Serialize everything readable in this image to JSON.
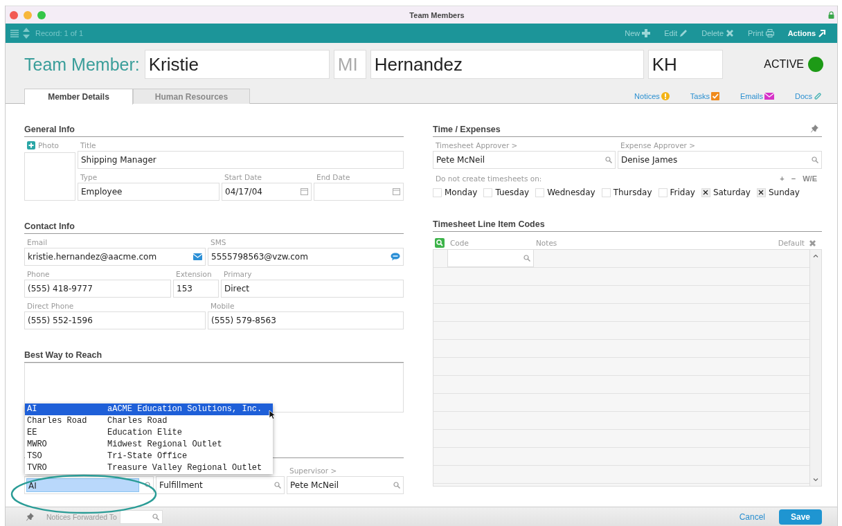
{
  "window": {
    "title": "Team Members",
    "locked": true
  },
  "toolbar": {
    "record": "Record: 1 of 1",
    "actions": [
      {
        "label": "New",
        "kind": "new",
        "disabled": true
      },
      {
        "label": "Edit",
        "kind": "edit",
        "disabled": true
      },
      {
        "label": "Delete",
        "kind": "delete",
        "disabled": true
      },
      {
        "label": "Print",
        "kind": "print",
        "disabled": true
      },
      {
        "label": "Actions",
        "kind": "actions",
        "disabled": false
      }
    ]
  },
  "header": {
    "label": "Team Member:",
    "first_name": "Kristie",
    "middle_initial": {
      "placeholder": "MI"
    },
    "last_name": "Hernandez",
    "initials": "KH",
    "status": "ACTIVE",
    "active": true
  },
  "tabs": [
    {
      "label": "Member Details",
      "selected": true
    },
    {
      "label": "Human Resources",
      "selected": false
    }
  ],
  "links": [
    {
      "label": "Notices",
      "kind": "notices"
    },
    {
      "label": "Tasks",
      "kind": "tasks"
    },
    {
      "label": "Emails",
      "kind": "emails"
    },
    {
      "label": "Docs",
      "kind": "docs"
    }
  ],
  "general_info": {
    "title": "General Info",
    "photo": "Photo",
    "title_field": {
      "label": "Title",
      "value": "Shipping Manager"
    },
    "type": {
      "label": "Type",
      "value": "Employee"
    },
    "start_date": {
      "label": "Start Date",
      "value": "04/17/04"
    },
    "end_date": {
      "label": "End Date"
    }
  },
  "contact_info": {
    "title": "Contact Info",
    "email": {
      "label": "Email",
      "value": "kristie.hernandez@aacme.com"
    },
    "sms": {
      "label": "SMS",
      "value": "5555798563@vzw.com"
    },
    "phone": {
      "label": "Phone",
      "value": "(555) 418-9777"
    },
    "extension": {
      "label": "Extension",
      "value": "153"
    },
    "primary": {
      "label": "Primary",
      "value": "Direct"
    },
    "direct_phone": {
      "label": "Direct Phone",
      "value": "(555) 552-1596"
    },
    "mobile": {
      "label": "Mobile",
      "value": "(555) 579-8563"
    }
  },
  "best_way": {
    "title": "Best Way to Reach"
  },
  "lower_fields": [
    {
      "value": "AI",
      "focused": true
    },
    {
      "value": "Fulfillment",
      "focused": false
    },
    {
      "label": "Supervisor >",
      "value": "Pete McNeil",
      "focused": false
    }
  ],
  "dropdown": [
    {
      "code": "AI",
      "name": "aACME Education Solutions, Inc.",
      "selected": true
    },
    {
      "code": "Charles Road",
      "name": "Charles Road",
      "selected": false
    },
    {
      "code": "EE",
      "name": "Education Elite",
      "selected": false
    },
    {
      "code": "MWRO",
      "name": "Midwest Regional Outlet",
      "selected": false
    },
    {
      "code": "TSO",
      "name": "Tri-State Office",
      "selected": false
    },
    {
      "code": "TVRO",
      "name": "Treasure Valley Regional Outlet",
      "selected": false
    }
  ],
  "time_expenses": {
    "title": "Time / Expenses",
    "timesheet_approver": {
      "label": "Timesheet Approver >",
      "value": "Pete McNeil"
    },
    "expense_approver": {
      "label": "Expense Approver >",
      "value": "Denise James"
    },
    "note": "Do not create timesheets on:",
    "controls": [
      "+",
      "−",
      "W/E"
    ],
    "days": [
      {
        "label": "Monday",
        "checked": false
      },
      {
        "label": "Tuesday",
        "checked": false
      },
      {
        "label": "Wednesday",
        "checked": false
      },
      {
        "label": "Thursday",
        "checked": false
      },
      {
        "label": "Friday",
        "checked": false
      },
      {
        "label": "Saturday",
        "checked": true
      },
      {
        "label": "Sunday",
        "checked": true
      }
    ]
  },
  "line_item_codes": {
    "title": "Timesheet Line Item Codes",
    "columns": [
      "Code",
      "Notes",
      "Default"
    ]
  },
  "footer": {
    "notices_label": "Notices Forwarded To",
    "cancel": "Cancel",
    "save": "Save"
  }
}
